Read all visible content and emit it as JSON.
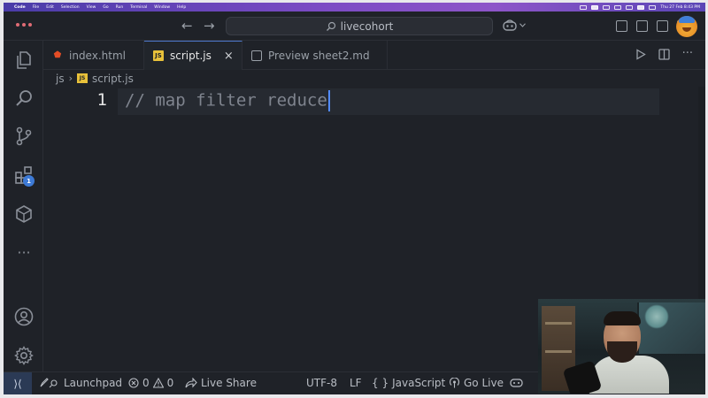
{
  "menubar": {
    "items": [
      "Code",
      "File",
      "Edit",
      "Selection",
      "View",
      "Go",
      "Run",
      "Terminal",
      "Window",
      "Help"
    ],
    "clock": "Thu 27 Feb 8:43 PM"
  },
  "titlebar": {
    "search_text": "livecohort",
    "nav_back": "←",
    "nav_forward": "→"
  },
  "activitybar": {
    "extensions_badge": "1",
    "more": "···"
  },
  "tabs": [
    {
      "label": "index.html",
      "icon": "html5-icon"
    },
    {
      "label": "script.js",
      "icon": "js-file-icon",
      "active": true
    },
    {
      "label": "Preview sheet2.md",
      "icon": "preview-icon"
    }
  ],
  "tab_close": "×",
  "breadcrumb": {
    "folder": "js",
    "separator": "›",
    "file": "script.js",
    "file_badge": "JS"
  },
  "editor": {
    "line_number": "1",
    "code": "// map filter reduce"
  },
  "statusbar": {
    "remote": "⟩⟨",
    "launchpad": "Launchpad",
    "errors": "0",
    "warnings": "0",
    "live_share": "Live Share",
    "encoding": "UTF-8",
    "eol": "LF",
    "language_braces": "{ }",
    "language": "JavaScript",
    "go_live": "Go Live"
  },
  "colors": {
    "accent": "#4d78cc",
    "editor_bg": "#1f2228",
    "comment": "#7f848e",
    "js_badge": "#e8c13a",
    "html_icon": "#e44d26"
  }
}
